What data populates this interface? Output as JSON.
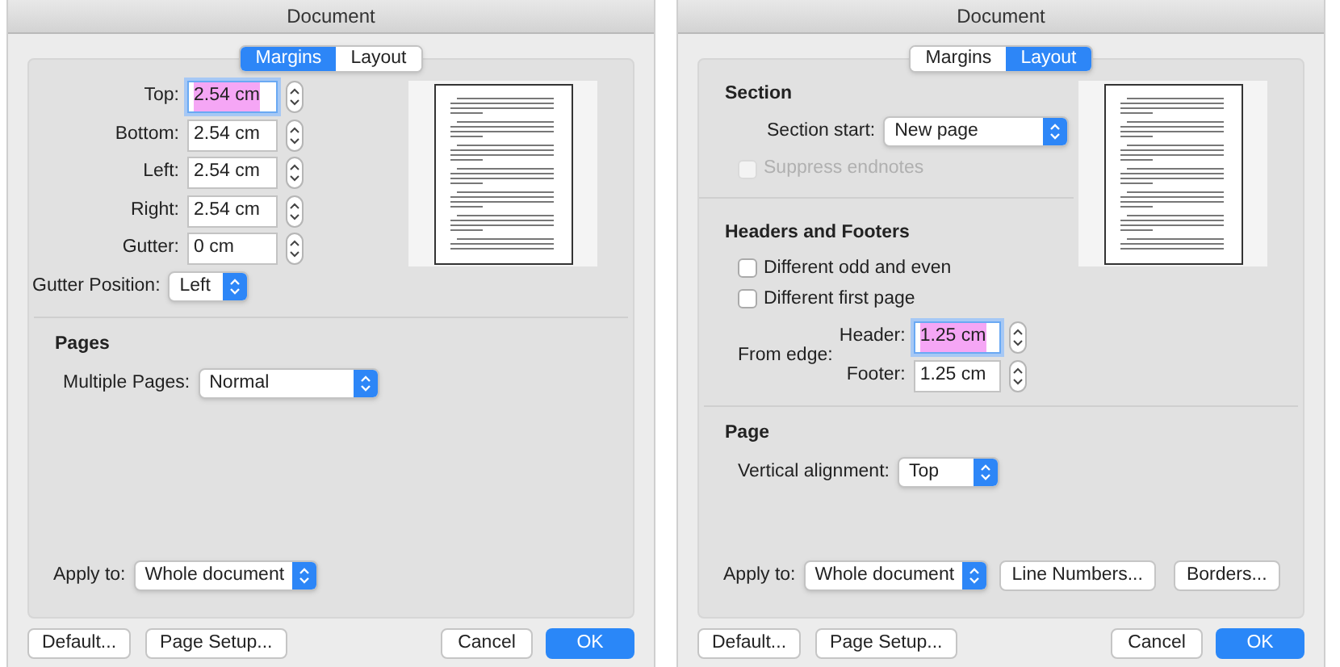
{
  "dialogs": [
    {
      "kind": "margins",
      "title": "Document",
      "tabs": [
        {
          "label": "Margins",
          "selected": true
        },
        {
          "label": "Layout",
          "selected": false
        }
      ],
      "fields": [
        {
          "label": "Top:",
          "value": "2.54 cm",
          "focused": true
        },
        {
          "label": "Bottom:",
          "value": "2.54 cm",
          "focused": false
        },
        {
          "label": "Left:",
          "value": "2.54 cm",
          "focused": false
        },
        {
          "label": "Right:",
          "value": "2.54 cm",
          "focused": false
        },
        {
          "label": "Gutter:",
          "value": "0 cm",
          "focused": false
        }
      ],
      "gutter_position": {
        "label": "Gutter Position:",
        "value": "Left"
      },
      "pages": {
        "heading": "Pages",
        "label": "Multiple Pages:",
        "value": "Normal"
      },
      "apply_to": {
        "label": "Apply to:",
        "value": "Whole document"
      },
      "left_buttons": [
        "Default...",
        "Page Setup..."
      ],
      "cancel": "Cancel",
      "ok": "OK"
    },
    {
      "kind": "layout",
      "title": "Document",
      "tabs": [
        {
          "label": "Margins",
          "selected": false
        },
        {
          "label": "Layout",
          "selected": true
        }
      ],
      "section": {
        "heading": "Section",
        "label": "Section start:",
        "value": "New page",
        "suppress": {
          "label": "Suppress endnotes",
          "checked": false,
          "disabled": true
        }
      },
      "headers_footers": {
        "heading": "Headers and Footers",
        "checkboxes": [
          {
            "label": "Different odd and even",
            "checked": false,
            "disabled": false
          },
          {
            "label": "Different first page",
            "checked": false,
            "disabled": false
          }
        ],
        "from_edge": "From edge:",
        "fields": [
          {
            "label": "Header:",
            "value": "1.25 cm",
            "focused": true
          },
          {
            "label": "Footer:",
            "value": "1.25 cm",
            "focused": false
          }
        ]
      },
      "page": {
        "heading": "Page",
        "label": "Vertical alignment:",
        "value": "Top"
      },
      "apply_to": {
        "label": "Apply to:",
        "value": "Whole document"
      },
      "extra_buttons": [
        "Line Numbers...",
        "Borders..."
      ],
      "left_buttons": [
        "Default...",
        "Page Setup..."
      ],
      "cancel": "Cancel",
      "ok": "OK"
    }
  ]
}
